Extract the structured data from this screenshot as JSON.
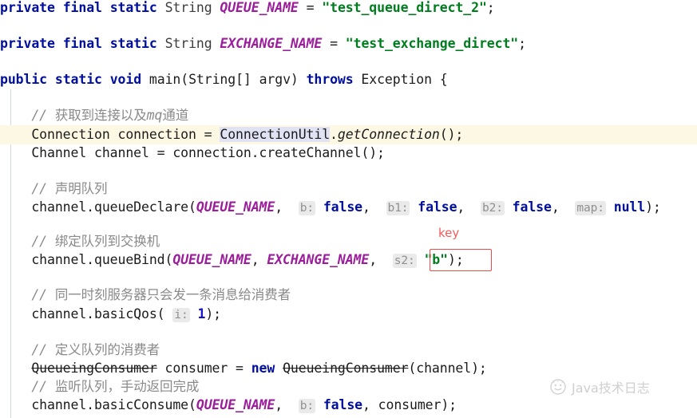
{
  "editor": {
    "language": "java",
    "background_color": "#ffffff",
    "current_line_highlight_color": "#fdf8e3",
    "identifier_highlight_color": "#e2e2f5",
    "colors": {
      "keyword": "#000f9e",
      "string": "#007d1e",
      "constant": "#9b1d9b",
      "comment": "#8a8a8a",
      "number": "#1616c8",
      "annotation_red": "#ef4b4b",
      "hint_background": "#eaeaea",
      "hint_text": "#909090"
    }
  },
  "code": {
    "lines": [
      {
        "id": "line-queue-name",
        "tokens": [
          {
            "t": "private",
            "c": "kw"
          },
          {
            "t": " ",
            "c": "plain"
          },
          {
            "t": "final",
            "c": "kw"
          },
          {
            "t": " ",
            "c": "plain"
          },
          {
            "t": "static",
            "c": "kw"
          },
          {
            "t": " ",
            "c": "plain"
          },
          {
            "t": "String",
            "c": "type"
          },
          {
            "t": " ",
            "c": "plain"
          },
          {
            "t": "QUEUE_NAME",
            "c": "const"
          },
          {
            "t": " = ",
            "c": "plain"
          },
          {
            "t": "\"test_queue_direct_2\"",
            "c": "str"
          },
          {
            "t": ";",
            "c": "plain"
          }
        ]
      },
      {
        "id": "line-exchange-name",
        "tokens": [
          {
            "t": "private",
            "c": "kw"
          },
          {
            "t": " ",
            "c": "plain"
          },
          {
            "t": "final",
            "c": "kw"
          },
          {
            "t": " ",
            "c": "plain"
          },
          {
            "t": "static",
            "c": "kw"
          },
          {
            "t": " ",
            "c": "plain"
          },
          {
            "t": "String",
            "c": "type"
          },
          {
            "t": " ",
            "c": "plain"
          },
          {
            "t": "EXCHANGE_NAME",
            "c": "const"
          },
          {
            "t": " = ",
            "c": "plain"
          },
          {
            "t": "\"test_exchange_direct\"",
            "c": "str"
          },
          {
            "t": ";",
            "c": "plain"
          }
        ]
      },
      {
        "id": "line-main-signature",
        "tokens": [
          {
            "t": "public",
            "c": "kw"
          },
          {
            "t": " ",
            "c": "plain"
          },
          {
            "t": "static",
            "c": "kw"
          },
          {
            "t": " ",
            "c": "plain"
          },
          {
            "t": "void",
            "c": "kw"
          },
          {
            "t": " main(String[] argv) ",
            "c": "plain"
          },
          {
            "t": "throws",
            "c": "kw"
          },
          {
            "t": " Exception {",
            "c": "plain"
          }
        ]
      },
      {
        "id": "line-comment-connection",
        "tokens": [
          {
            "t": "    // ",
            "c": "cmt"
          },
          {
            "t": "获取到连接以及",
            "c": "cmt-cn"
          },
          {
            "t": "mq",
            "c": "cmt"
          },
          {
            "t": "通道",
            "c": "cmt-cn"
          }
        ]
      },
      {
        "id": "line-connection",
        "tokens": [
          {
            "t": "    Connection connection = ",
            "c": "plain"
          },
          {
            "t": "ConnectionUtil",
            "c": "clshl"
          },
          {
            "t": ".",
            "c": "plain"
          },
          {
            "t": "getConnection",
            "c": "meth"
          },
          {
            "t": "();",
            "c": "plain"
          }
        ]
      },
      {
        "id": "line-channel",
        "tokens": [
          {
            "t": "    Channel channel = connection.createChannel();",
            "c": "plain"
          }
        ]
      },
      {
        "id": "line-comment-declare-queue",
        "tokens": [
          {
            "t": "    // ",
            "c": "cmt"
          },
          {
            "t": "声明队列",
            "c": "cmt-cn"
          }
        ]
      },
      {
        "id": "line-queue-declare",
        "tokens": [
          {
            "t": "    channel.queueDeclare(",
            "c": "plain"
          },
          {
            "t": "QUEUE_NAME",
            "c": "const"
          },
          {
            "t": ",  ",
            "c": "plain"
          },
          {
            "t": "b:",
            "c": "hint"
          },
          {
            "t": " ",
            "c": "plain"
          },
          {
            "t": "false",
            "c": "kw"
          },
          {
            "t": ",  ",
            "c": "plain"
          },
          {
            "t": "b1:",
            "c": "hint"
          },
          {
            "t": " ",
            "c": "plain"
          },
          {
            "t": "false",
            "c": "kw"
          },
          {
            "t": ",  ",
            "c": "plain"
          },
          {
            "t": "b2:",
            "c": "hint"
          },
          {
            "t": " ",
            "c": "plain"
          },
          {
            "t": "false",
            "c": "kw"
          },
          {
            "t": ",  ",
            "c": "plain"
          },
          {
            "t": "map:",
            "c": "hint"
          },
          {
            "t": " ",
            "c": "plain"
          },
          {
            "t": "null",
            "c": "nullv"
          },
          {
            "t": ");",
            "c": "plain"
          }
        ]
      },
      {
        "id": "line-comment-bind",
        "tokens": [
          {
            "t": "    // ",
            "c": "cmt"
          },
          {
            "t": "绑定队列到交换机",
            "c": "cmt-cn"
          }
        ]
      },
      {
        "id": "line-queue-bind",
        "tokens": [
          {
            "t": "    channel.queueBind(",
            "c": "plain"
          },
          {
            "t": "QUEUE_NAME",
            "c": "const"
          },
          {
            "t": ", ",
            "c": "plain"
          },
          {
            "t": "EXCHANGE_NAME",
            "c": "const"
          },
          {
            "t": ",  ",
            "c": "plain"
          },
          {
            "t": "s2:",
            "c": "hint"
          },
          {
            "t": " ",
            "c": "plain"
          },
          {
            "t": "\"b\"",
            "c": "str"
          },
          {
            "t": ");",
            "c": "plain"
          }
        ]
      },
      {
        "id": "line-comment-qos",
        "tokens": [
          {
            "t": "    // ",
            "c": "cmt"
          },
          {
            "t": "同一时刻服务器只会发一条消息给消费者",
            "c": "cmt-cn"
          }
        ]
      },
      {
        "id": "line-basic-qos",
        "tokens": [
          {
            "t": "    channel.basicQos( ",
            "c": "plain"
          },
          {
            "t": "i:",
            "c": "hint"
          },
          {
            "t": " ",
            "c": "plain"
          },
          {
            "t": "1",
            "c": "num"
          },
          {
            "t": ");",
            "c": "plain"
          }
        ]
      },
      {
        "id": "line-comment-consumer",
        "tokens": [
          {
            "t": "    // ",
            "c": "cmt"
          },
          {
            "t": "定义队列的消费者",
            "c": "cmt-cn"
          }
        ]
      },
      {
        "id": "line-queueing-consumer",
        "tokens": [
          {
            "t": "    ",
            "c": "plain"
          },
          {
            "t": "QueueingConsumer",
            "c": "depr"
          },
          {
            "t": " consumer = ",
            "c": "plain"
          },
          {
            "t": "new",
            "c": "kw"
          },
          {
            "t": " ",
            "c": "plain"
          },
          {
            "t": "QueueingConsumer",
            "c": "depr"
          },
          {
            "t": "(channel);",
            "c": "plain"
          }
        ]
      },
      {
        "id": "line-comment-listen",
        "tokens": [
          {
            "t": "    // ",
            "c": "cmt"
          },
          {
            "t": "监听队列，手动返回完成",
            "c": "cmt-cn"
          }
        ]
      },
      {
        "id": "line-basic-consume",
        "tokens": [
          {
            "t": "    channel.basicConsume(",
            "c": "plain"
          },
          {
            "t": "QUEUE_NAME",
            "c": "const"
          },
          {
            "t": ",  ",
            "c": "plain"
          },
          {
            "t": "b:",
            "c": "hint"
          },
          {
            "t": " ",
            "c": "plain"
          },
          {
            "t": "false",
            "c": "kw"
          },
          {
            "t": ", consumer);",
            "c": "plain"
          }
        ]
      }
    ]
  },
  "annotation": {
    "label": "key",
    "target_text": "s2: \"b\")",
    "color": "#ef4b4b"
  },
  "watermark": {
    "text": "Java技术日志",
    "icon": "smiley-face-logo-icon"
  }
}
